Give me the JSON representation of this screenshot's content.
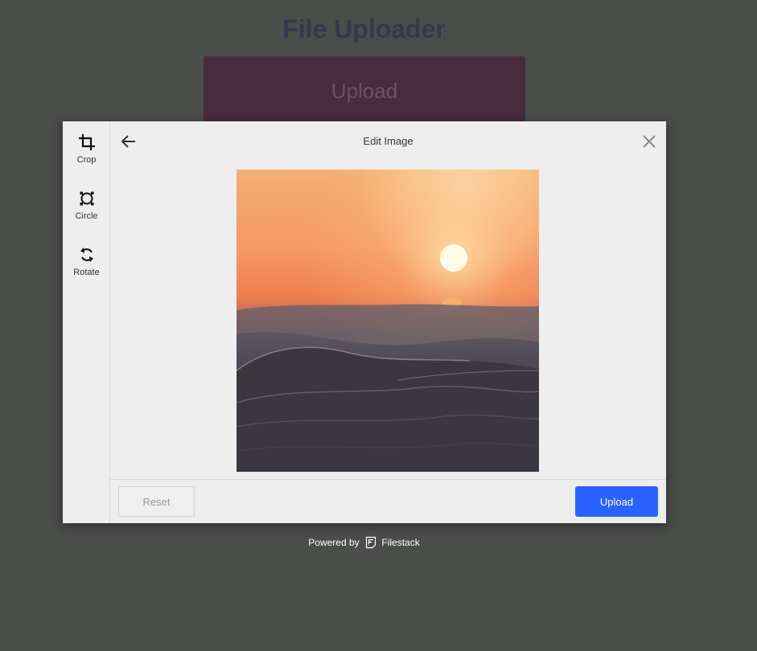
{
  "page": {
    "title": "File Uploader",
    "upload_button_label": "Upload"
  },
  "modal": {
    "header_title": "Edit Image",
    "tools": [
      {
        "label": "Crop",
        "icon": "crop-icon"
      },
      {
        "label": "Circle",
        "icon": "circle-icon"
      },
      {
        "label": "Rotate",
        "icon": "rotate-icon"
      }
    ],
    "footer": {
      "reset_label": "Reset",
      "upload_label": "Upload"
    }
  },
  "powered_by": {
    "prefix": "Powered by",
    "brand": "Filestack",
    "icon": "filestack-logo-icon"
  },
  "colors": {
    "background_overlay": "#4b4d4b",
    "modal_bg": "#eeeeee",
    "upload_accent": "#2962ff",
    "bg_upload_button": "#492c3c"
  }
}
